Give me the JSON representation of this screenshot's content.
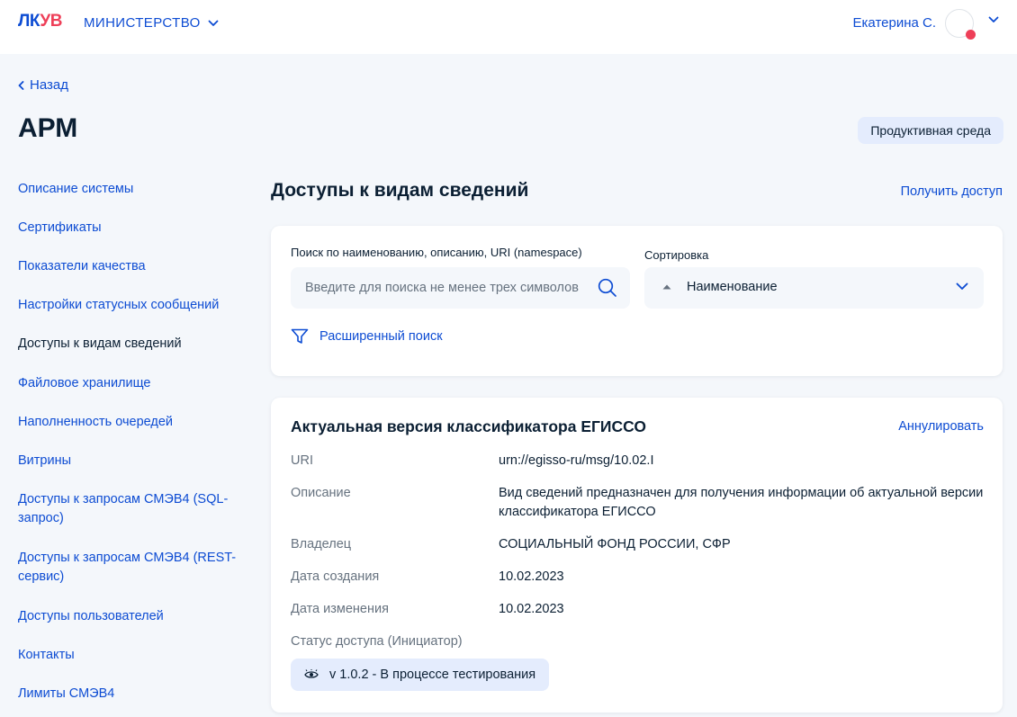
{
  "header": {
    "logo_lk": "ЛК",
    "logo_uv": "УВ",
    "ministry_label": "МИНИСТЕРСТВО",
    "user_name": "Екатерина С."
  },
  "nav": {
    "back_label": "Назад",
    "page_title": "АРМ",
    "environment_badge": "Продуктивная среда"
  },
  "sidebar": {
    "items": [
      {
        "label": "Описание системы"
      },
      {
        "label": "Сертификаты"
      },
      {
        "label": "Показатели качества"
      },
      {
        "label": "Настройки статусных сообщений"
      },
      {
        "label": "Доступы к видам сведений",
        "active": true
      },
      {
        "label": "Файловое хранилище"
      },
      {
        "label": "Наполненность очередей"
      },
      {
        "label": "Витрины"
      },
      {
        "label": "Доступы к запросам СМЭВ4 (SQL-запрос)"
      },
      {
        "label": "Доступы к запросам СМЭВ4 (REST-сервис)"
      },
      {
        "label": "Доступы пользователей"
      },
      {
        "label": "Контакты"
      },
      {
        "label": "Лимиты СМЭВ4"
      }
    ]
  },
  "main": {
    "section_title": "Доступы к видам сведений",
    "get_access_label": "Получить доступ",
    "search": {
      "label": "Поиск по наименованию, описанию, URI (namespace)",
      "placeholder": "Введите для поиска не менее трех символов",
      "value": ""
    },
    "sort": {
      "label": "Сортировка",
      "value": "Наименование"
    },
    "advanced_search_label": "Расширенный поиск",
    "card": {
      "title": "Актуальная версия классификатора ЕГИССО",
      "annul_label": "Аннулировать",
      "fields": [
        {
          "key": "URI",
          "value": "urn://egisso-ru/msg/10.02.I"
        },
        {
          "key": "Описание",
          "value": "Вид сведений предназначен для получения информации об актуальной версии классификатора ЕГИССО"
        },
        {
          "key": "Владелец",
          "value": "СОЦИАЛЬНЫЙ ФОНД РОССИИ, СФР"
        },
        {
          "key": "Дата создания",
          "value": "10.02.2023"
        },
        {
          "key": "Дата изменения",
          "value": "10.02.2023"
        }
      ],
      "status_label": "Статус доступа (Инициатор)",
      "status_value": "v 1.0.2 - В процессе тестирования"
    }
  },
  "colors": {
    "accent": "#0d4cd3",
    "brand_red": "#ee3f58",
    "chip_bg": "#e4ecfd"
  }
}
